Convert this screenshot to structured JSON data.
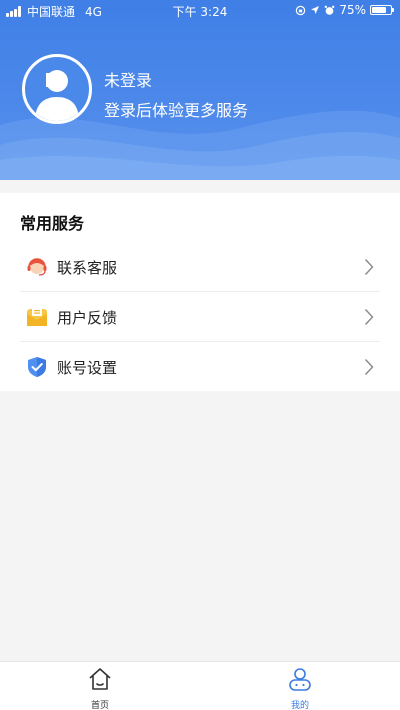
{
  "status_bar": {
    "carrier": "中国联通",
    "network": "4G",
    "time": "下午 3:24",
    "battery": "75%",
    "battery_level": 0.75
  },
  "profile": {
    "name": "未登录",
    "subtitle": "登录后体验更多服务"
  },
  "services": {
    "title": "常用服务",
    "items": [
      {
        "label": "联系客服",
        "icon": "customer-service-icon"
      },
      {
        "label": "用户反馈",
        "icon": "feedback-mail-icon"
      },
      {
        "label": "账号设置",
        "icon": "account-shield-icon"
      }
    ]
  },
  "tabbar": {
    "tabs": [
      {
        "label": "首页",
        "icon": "home-icon",
        "active": false
      },
      {
        "label": "我的",
        "icon": "profile-icon",
        "active": true
      }
    ]
  },
  "colors": {
    "primary": "#3b7be3",
    "header_gradient_top": "#3f7fe6",
    "header_gradient_bottom": "#5a93ee"
  }
}
